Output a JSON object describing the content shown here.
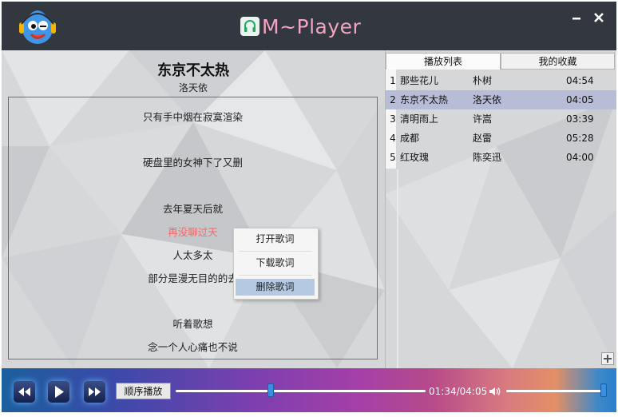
{
  "app": {
    "title": "M~Player"
  },
  "now_playing": {
    "title": "东京不太热",
    "artist": "洛天依"
  },
  "lyrics": {
    "lines": [
      "只有手中烟在寂寞渲染",
      "硬盘里的女神下了又删",
      "去年夏天后就",
      "再没聊过天",
      "人太多太",
      "部分是漫无目的的去",
      "听着歌想",
      "念一个人心痛也不说"
    ],
    "active_index": 3
  },
  "context_menu": {
    "items": [
      "打开歌词",
      "下载歌词",
      "删除歌词"
    ],
    "highlighted_index": 2
  },
  "tabs": [
    "播放列表",
    "我的收藏"
  ],
  "playlist": {
    "rows": [
      {
        "index": "1",
        "name": "那些花儿",
        "artist": "朴树",
        "duration": "04:54"
      },
      {
        "index": "2",
        "name": "东京不太热",
        "artist": "洛天依",
        "duration": "04:05"
      },
      {
        "index": "3",
        "name": "清明雨上",
        "artist": "许嵩",
        "duration": "03:39"
      },
      {
        "index": "4",
        "name": "成都",
        "artist": "赵雷",
        "duration": "05:28"
      },
      {
        "index": "5",
        "name": "红玫瑰",
        "artist": "陈奕迅",
        "duration": "04:00"
      }
    ],
    "selected_index": 1
  },
  "controls": {
    "mode_label": "顺序播放",
    "time_text": "01:34/04:05",
    "progress": 0.38,
    "volume": 1.0
  },
  "icons": {
    "logo": "blue-monster-logo-icon",
    "title": "headphones-icon",
    "prev": "previous-icon",
    "play": "play-icon",
    "next": "next-icon",
    "volume": "volume-icon",
    "add": "plus-icon"
  },
  "colors": {
    "titlebar": "#33373f",
    "title_text": "#f2a5c0",
    "active_lyric": "#f06a6a",
    "selected_row": "#b7bdd6",
    "menu_highlight": "#b6c9e3",
    "slider_knob": "#3a8fe0"
  }
}
